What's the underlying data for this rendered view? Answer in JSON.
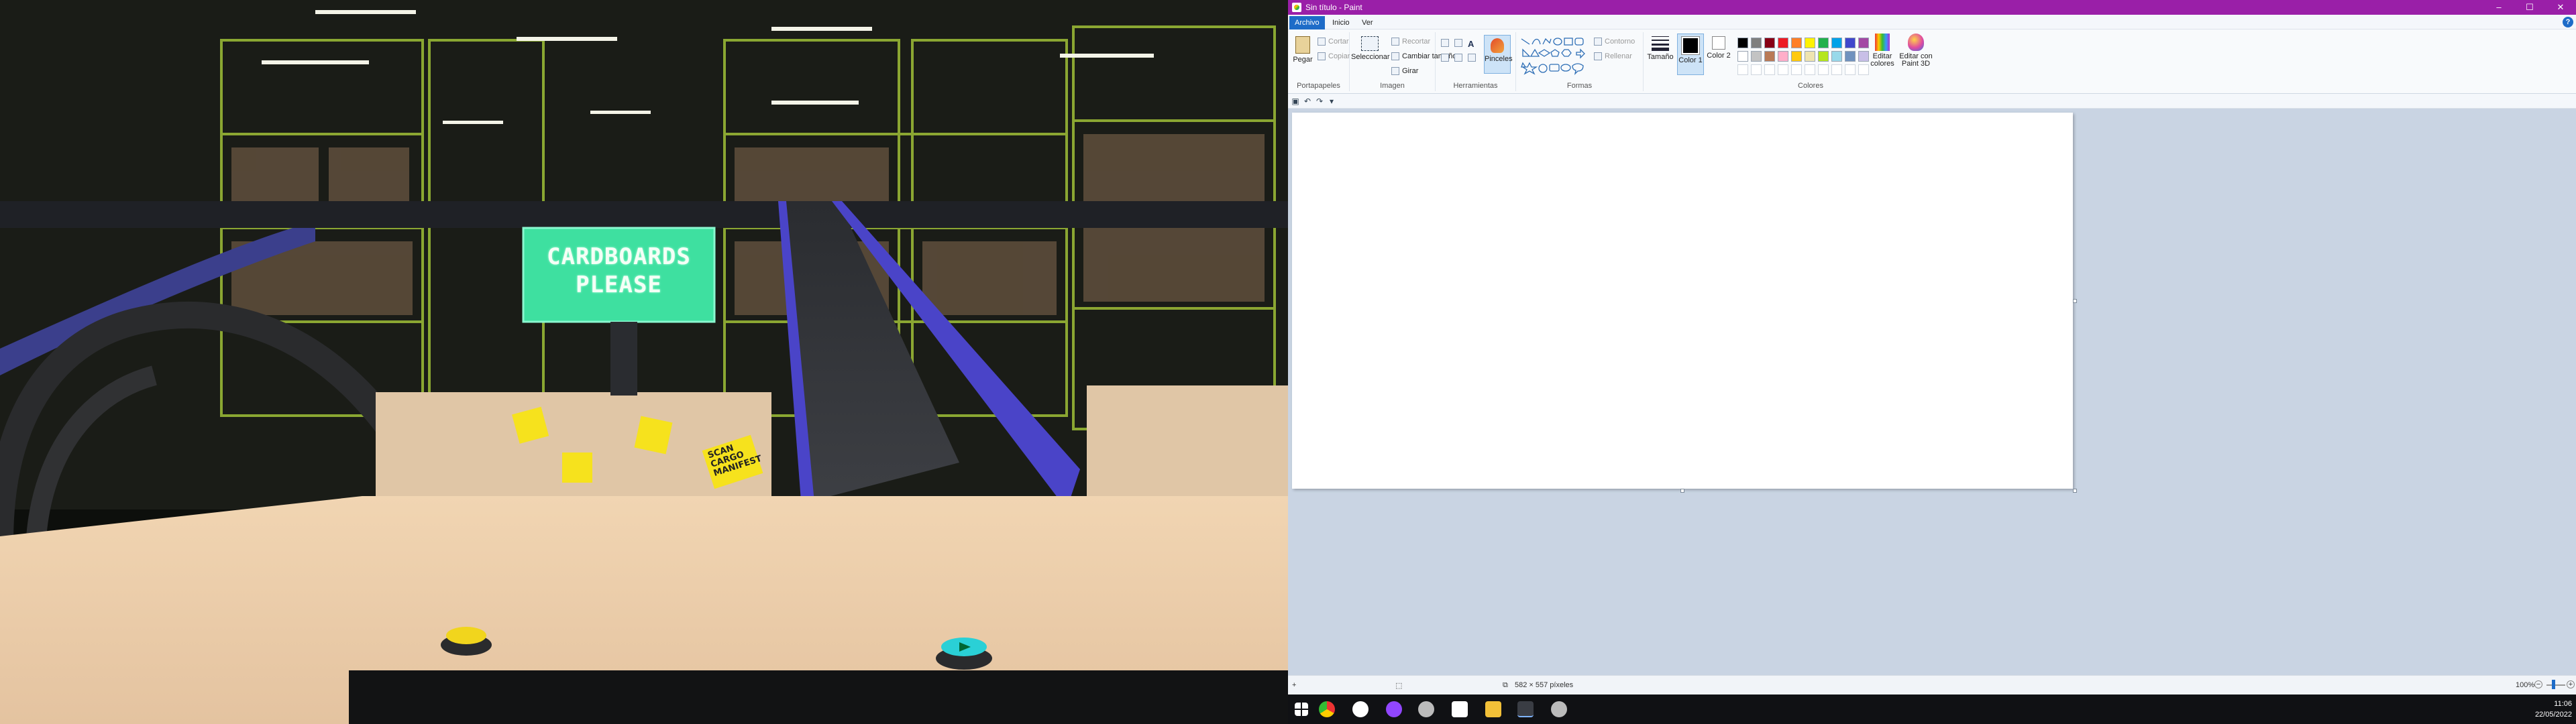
{
  "game": {
    "sign_line1": "CARDBOARDS",
    "sign_line2": "PLEASE",
    "scan_note": "SCAN CARGO MANIFEST",
    "button_left_icon": "scan-button-icon",
    "button_right_icon": "play-button-icon",
    "colors": {
      "sign": "#3ee0a0",
      "floor": "#efd3b1",
      "belt_rail": "#4a44c8",
      "shelf": "#a6c63a",
      "note": "#f6e21d"
    }
  },
  "paint": {
    "window_title": "Sin título - Paint",
    "title_buttons": {
      "minimize": "–",
      "maximize": "☐",
      "close": "✕"
    },
    "menu": {
      "file": "Archivo",
      "home": "Inicio",
      "view": "Ver",
      "help": "?"
    },
    "groups": {
      "clipboard": "Portapapeles",
      "image": "Imagen",
      "tools": "Herramientas",
      "shapes": "Formas",
      "colors": "Colores"
    },
    "clipboard": {
      "paste": "Pegar",
      "cut": "Cortar",
      "copy": "Copiar"
    },
    "image": {
      "select": "Seleccionar",
      "crop": "Recortar",
      "resize": "Cambiar tamaño",
      "rotate": "Girar"
    },
    "tools": {
      "brushes": "Pinceles"
    },
    "shapes": {
      "outline": "Contorno",
      "fill": "Rellenar"
    },
    "size": {
      "label": "Tamaño"
    },
    "color1": {
      "label": "Color 1",
      "value": "#000000"
    },
    "color2": {
      "label": "Color 2",
      "value": "#ffffff"
    },
    "edit_colors": "Editar colores",
    "edit_paint3d": "Editar con Paint 3D",
    "palette_row1": [
      "#000000",
      "#7f7f7f",
      "#880015",
      "#ed1c24",
      "#ff7f27",
      "#fff200",
      "#22b14c",
      "#00a2e8",
      "#3f48cc",
      "#a349a4"
    ],
    "palette_row2": [
      "#ffffff",
      "#c3c3c3",
      "#b97a57",
      "#ffaec9",
      "#ffc90e",
      "#efe4b0",
      "#b5e61d",
      "#99d9ea",
      "#7092be",
      "#c8bfe7"
    ],
    "status": {
      "dimensions": "582 × 557 píxeles",
      "zoom": "100%"
    },
    "clock": {
      "time": "11:06",
      "date": "22/05/2022"
    }
  }
}
